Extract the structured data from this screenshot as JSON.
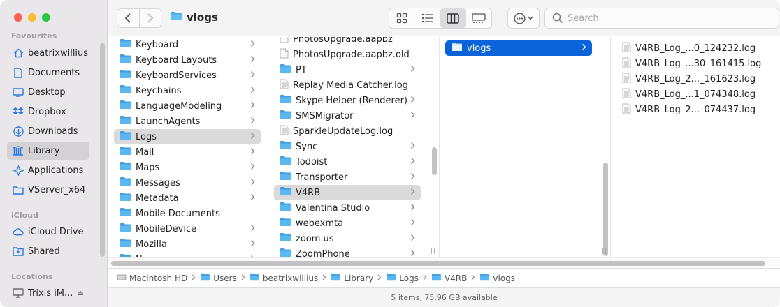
{
  "window": {
    "title": "vlogs"
  },
  "sidebar": {
    "sections": {
      "favourites": "Favourites",
      "icloud": "iCloud",
      "locations": "Locations"
    },
    "favourites": [
      {
        "label": "beatrixwillius",
        "icon": "home-icon"
      },
      {
        "label": "Documents",
        "icon": "document-icon"
      },
      {
        "label": "Desktop",
        "icon": "desktop-icon"
      },
      {
        "label": "Dropbox",
        "icon": "dropbox-icon"
      },
      {
        "label": "Downloads",
        "icon": "download-icon"
      },
      {
        "label": "Library",
        "icon": "library-icon",
        "selected": true
      },
      {
        "label": "Applications",
        "icon": "applications-icon"
      },
      {
        "label": "VServer_x64",
        "icon": "folder-outline-icon"
      }
    ],
    "icloud": [
      {
        "label": "iCloud Drive",
        "icon": "cloud-icon"
      },
      {
        "label": "Shared",
        "icon": "shared-folder-icon"
      }
    ],
    "locations": [
      {
        "label": "Trixis iM...",
        "icon": "computer-icon"
      }
    ]
  },
  "toolbar": {
    "search_placeholder": "Search"
  },
  "column1": [
    {
      "label": "Keyboard",
      "folder": true
    },
    {
      "label": "Keyboard Layouts",
      "folder": true
    },
    {
      "label": "KeyboardServices",
      "folder": true
    },
    {
      "label": "Keychains",
      "folder": true
    },
    {
      "label": "LanguageModeling",
      "folder": true
    },
    {
      "label": "LaunchAgents",
      "folder": true
    },
    {
      "label": "Logs",
      "folder": true,
      "selected": true
    },
    {
      "label": "Mail",
      "folder": true
    },
    {
      "label": "Maps",
      "folder": true
    },
    {
      "label": "Messages",
      "folder": true
    },
    {
      "label": "Metadata",
      "folder": true
    },
    {
      "label": "Mobile Documents",
      "folder": true,
      "nochev": true
    },
    {
      "label": "MobileDevice",
      "folder": true
    },
    {
      "label": "Mozilla",
      "folder": true
    },
    {
      "label": "N...",
      "folder": true
    }
  ],
  "column2": [
    {
      "label": "PhotosUpgrade.aapbz",
      "folder": false
    },
    {
      "label": "PhotosUpgrade.aapbz.old",
      "folder": false
    },
    {
      "label": "PT",
      "folder": true
    },
    {
      "label": "Replay Media Catcher.log",
      "folder": false,
      "log": true
    },
    {
      "label": "Skype Helper (Renderer)",
      "folder": true
    },
    {
      "label": "SMSMigrator",
      "folder": true
    },
    {
      "label": "SparkleUpdateLog.log",
      "folder": false,
      "log": true
    },
    {
      "label": "Sync",
      "folder": true
    },
    {
      "label": "Todoist",
      "folder": true
    },
    {
      "label": "Transporter",
      "folder": true
    },
    {
      "label": "V4RB",
      "folder": true,
      "selected": true
    },
    {
      "label": "Valentina Studio",
      "folder": true
    },
    {
      "label": "webexmta",
      "folder": true
    },
    {
      "label": "zoom.us",
      "folder": true
    },
    {
      "label": "ZoomPhone",
      "folder": true
    }
  ],
  "column3": [
    {
      "label": "vlogs",
      "folder": true,
      "selected": true
    }
  ],
  "column4": [
    {
      "label": "V4RB_Log_...0_124232.log"
    },
    {
      "label": "V4RB_Log_...30_161415.log"
    },
    {
      "label": "V4RB_Log_2..._161623.log"
    },
    {
      "label": "V4RB_Log_...1_074348.log"
    },
    {
      "label": "V4RB_Log_2..._074437.log"
    }
  ],
  "pathbar": [
    {
      "label": "Macintosh HD",
      "icon": "disk-icon"
    },
    {
      "label": "Users",
      "icon": "folder-icon"
    },
    {
      "label": "beatrixwillius",
      "icon": "home-folder-icon"
    },
    {
      "label": "Library",
      "icon": "folder-icon"
    },
    {
      "label": "Logs",
      "icon": "folder-icon"
    },
    {
      "label": "V4RB",
      "icon": "folder-icon"
    },
    {
      "label": "vlogs",
      "icon": "folder-icon"
    }
  ],
  "status": {
    "text": "5 items, 75,96 GB available"
  },
  "colors": {
    "accent": "#0a63d8",
    "folder": "#4aa8e8"
  }
}
